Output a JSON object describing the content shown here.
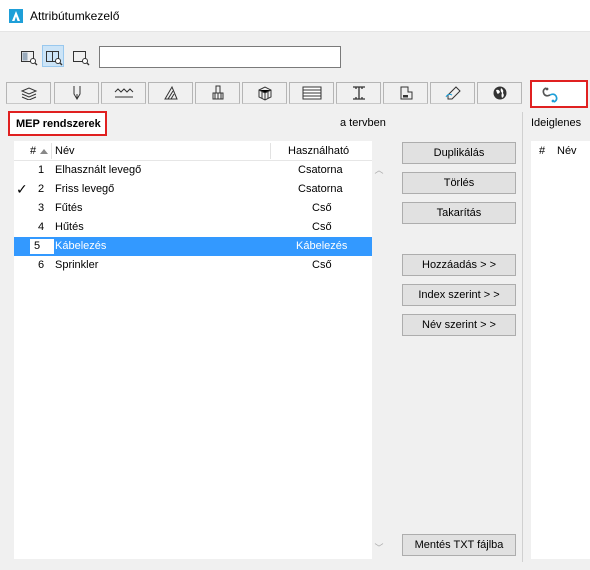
{
  "window": {
    "title": "Attribútumkezelő"
  },
  "search": {
    "value": ""
  },
  "left_panel": {
    "title": "MEP rendszerek",
    "location_label": "a tervben",
    "columns": {
      "num": "#",
      "name": "Név",
      "usage": "Használható"
    },
    "rows": [
      {
        "num": "1",
        "name": "Elhasznált levegő",
        "usage": "Csatorna",
        "checked": false,
        "selected": false
      },
      {
        "num": "2",
        "name": "Friss levegő",
        "usage": "Csatorna",
        "checked": true,
        "selected": false
      },
      {
        "num": "3",
        "name": "Fűtés",
        "usage": "Cső",
        "checked": false,
        "selected": false
      },
      {
        "num": "4",
        "name": "Hűtés",
        "usage": "Cső",
        "checked": false,
        "selected": false
      },
      {
        "num": "5",
        "name": "Kábelezés",
        "usage": "Kábelezés",
        "checked": false,
        "selected": true
      },
      {
        "num": "6",
        "name": "Sprinkler",
        "usage": "Cső",
        "checked": false,
        "selected": false
      }
    ],
    "check_mark": "✓"
  },
  "buttons": {
    "duplicate": "Duplikálás",
    "delete": "Törlés",
    "cleanup": "Takarítás",
    "add": "Hozzáadás > >",
    "by_index": "Index szerint > >",
    "by_name": "Név szerint > >",
    "save_txt": "Mentés TXT fájlba"
  },
  "right_panel": {
    "title": "Ideiglenes",
    "columns": {
      "num": "#",
      "name": "Név"
    }
  },
  "scroll": {
    "up": "︿",
    "down": "﹀"
  },
  "tabs": [
    "layers-icon",
    "pen-icon",
    "line-types-icon",
    "fill-types-icon",
    "surfaces-icon",
    "building-materials-icon",
    "composites-icon",
    "profiles-icon",
    "zones-icon",
    "markup-icon",
    "globe-icon",
    "mep-systems-icon"
  ],
  "colors": {
    "selection": "#3399ff",
    "highlight": "#e02020",
    "accent": "#1e9fd8"
  }
}
